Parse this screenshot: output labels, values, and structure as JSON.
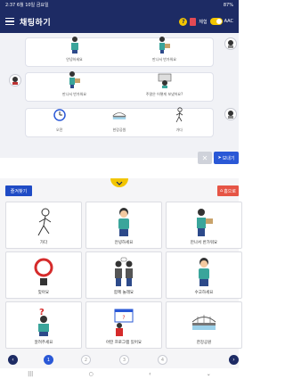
{
  "statusbar": {
    "time": "2:37 6월 10일 금요일",
    "right": "87%"
  },
  "appbar": {
    "title": "채팅하기",
    "help": "?",
    "mode": "체험",
    "aac": "AAC"
  },
  "chat": {
    "row1": {
      "item1": "안녕하세요",
      "item2": "만나서 반가워요"
    },
    "row2": {
      "item1": "만나서 반가워요",
      "item2": "주말은 어떻게 보냈어요?"
    },
    "row3": {
      "item1": "오전",
      "item2": "한강공원",
      "item3": "가다"
    }
  },
  "input": {
    "clear": "✕",
    "send": "보내기"
  },
  "tabs": {
    "favorites": "즐겨찾기",
    "home": "홈으로"
  },
  "grid": {
    "cells": [
      {
        "label": "가다",
        "icon": "walking-person-icon"
      },
      {
        "label": "안녕하세요",
        "icon": "waving-boy-icon"
      },
      {
        "label": "만나서 반가워요",
        "icon": "handshake-icon"
      },
      {
        "label": "맞아요",
        "icon": "correct-circle-icon"
      },
      {
        "label": "함께 놀래요",
        "icon": "two-people-icon"
      },
      {
        "label": "수고하세요",
        "icon": "boy-icon"
      },
      {
        "label": "알려주세요",
        "icon": "question-boy-icon"
      },
      {
        "label": "어떤 프로그램 있어요",
        "icon": "program-board-icon"
      },
      {
        "label": "한강공원",
        "icon": "bridge-icon"
      }
    ]
  },
  "pager": {
    "prev": "‹",
    "pages": [
      "1",
      "2",
      "3",
      "4"
    ],
    "next": "›"
  },
  "navbar": {
    "menu": "|||",
    "home": "○",
    "back": "‹",
    "down": "⌄"
  },
  "colors": {
    "primary": "#1d2b64",
    "accent": "#f2c500",
    "blue": "#2a58d6",
    "red": "#e65546"
  }
}
